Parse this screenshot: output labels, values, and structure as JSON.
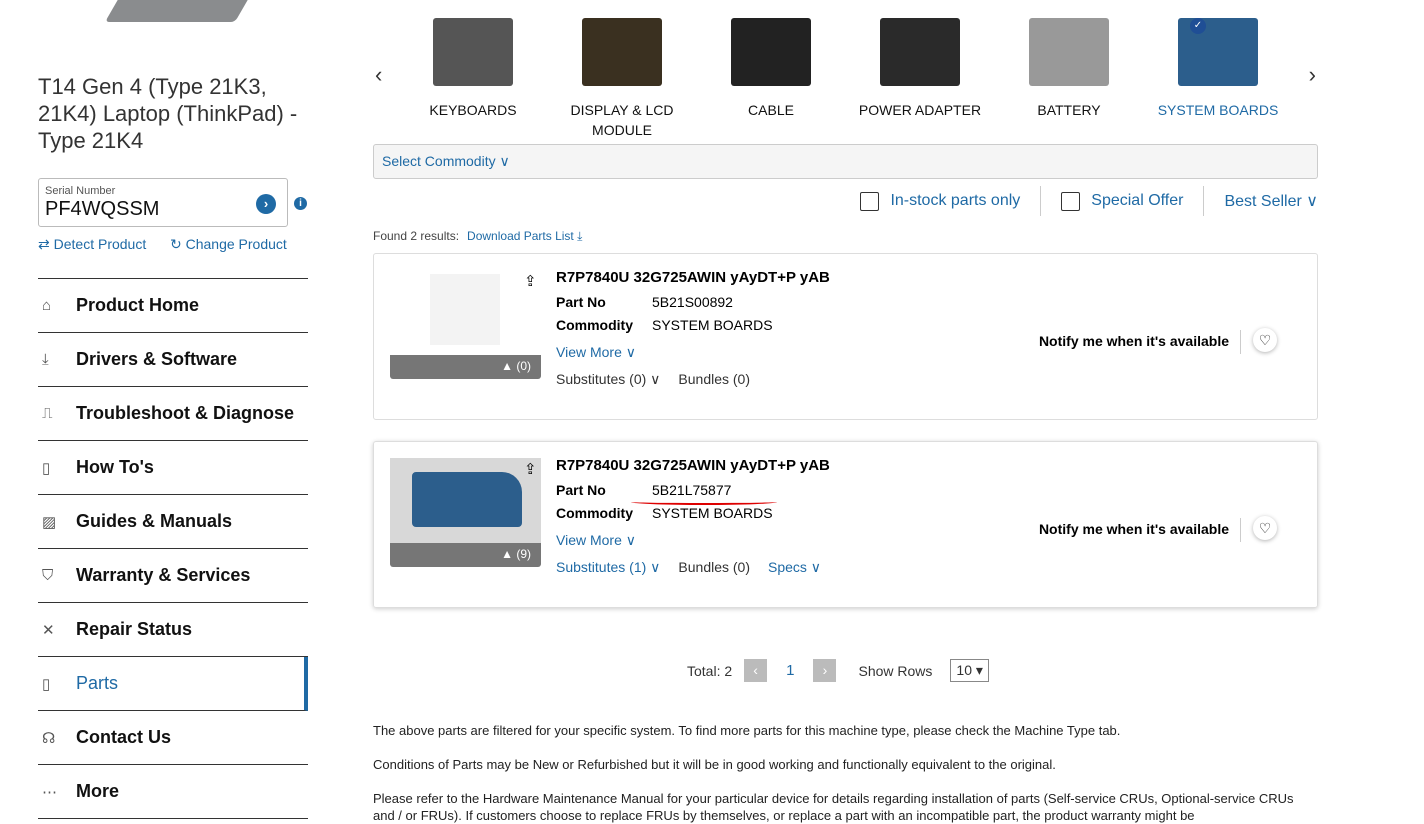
{
  "product": {
    "title": "T14 Gen 4 (Type 21K3, 21K4) Laptop (ThinkPad) - Type 21K4",
    "serial_label": "Serial Number",
    "serial_value": "PF4WQSSM",
    "detect": "Detect Product",
    "change": "Change Product"
  },
  "nav": [
    {
      "label": "Product Home",
      "icon": "⌂"
    },
    {
      "label": "Drivers & Software",
      "icon": "⤓"
    },
    {
      "label": "Troubleshoot & Diagnose",
      "icon": "⎍"
    },
    {
      "label": "How To's",
      "icon": "▯"
    },
    {
      "label": "Guides & Manuals",
      "icon": "▨"
    },
    {
      "label": "Warranty & Services",
      "icon": "⛉"
    },
    {
      "label": "Repair Status",
      "icon": "✕"
    },
    {
      "label": "Parts",
      "icon": "▯"
    },
    {
      "label": "Contact Us",
      "icon": "☊"
    },
    {
      "label": "More",
      "icon": "⋯"
    }
  ],
  "categories": [
    {
      "label": "KEYBOARDS",
      "color": "#555"
    },
    {
      "label": "DISPLAY & LCD MODULE",
      "color": "#3a3020"
    },
    {
      "label": "CABLE",
      "color": "#222"
    },
    {
      "label": "POWER ADAPTER",
      "color": "#2a2a2a"
    },
    {
      "label": "BATTERY",
      "color": "#999"
    },
    {
      "label": "SYSTEM BOARDS",
      "color": "#2c5e8c"
    }
  ],
  "filters": {
    "commodity": "Select Commodity ∨",
    "instock": "In-stock parts only",
    "special": "Special Offer",
    "sort": "Best Seller ∨"
  },
  "found": "Found 2 results:",
  "download": "Download Parts List ⤓",
  "results": [
    {
      "name": "R7P7840U 32G725AWIN yAyDT+P yAB",
      "partno_label": "Part No",
      "partno": "5B21S00892",
      "commodity_label": "Commodity",
      "commodity": "SYSTEM BOARDS",
      "view_more": "View More ∨",
      "images": "(0)",
      "substitutes": "Substitutes (0) ∨",
      "bundles": "Bundles (0)",
      "notify": "Notify me when it's available"
    },
    {
      "name": "R7P7840U 32G725AWIN yAyDT+P yAB",
      "partno_label": "Part No",
      "partno": "5B21L75877",
      "commodity_label": "Commodity",
      "commodity": "SYSTEM BOARDS",
      "view_more": "View More ∨",
      "images": "(9)",
      "substitutes": "Substitutes (1) ∨",
      "bundles": "Bundles (0)",
      "specs": "Specs ∨",
      "notify": "Notify me when it's available"
    }
  ],
  "pager": {
    "total": "Total: 2",
    "prev": "‹",
    "page": "1",
    "next": "›",
    "rows_label": "Show Rows",
    "rows": "10 ▾"
  },
  "notes": [
    "The above parts are filtered for your specific system. To find more parts for this machine type, please check the Machine Type tab.",
    "Conditions of Parts may be New or Refurbished but it will be in good working and functionally equivalent to the original.",
    "Please refer to the Hardware Maintenance Manual for your particular device for details regarding installation of parts (Self-service CRUs, Optional-service CRUs and / or FRUs). If customers choose to replace FRUs by themselves, or replace a part with an incompatible part, the product warranty might be"
  ]
}
